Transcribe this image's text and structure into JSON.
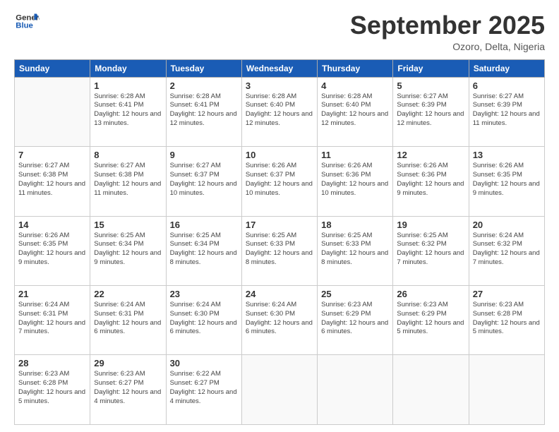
{
  "header": {
    "logo_line1": "General",
    "logo_line2": "Blue",
    "month": "September 2025",
    "location": "Ozoro, Delta, Nigeria"
  },
  "weekdays": [
    "Sunday",
    "Monday",
    "Tuesday",
    "Wednesday",
    "Thursday",
    "Friday",
    "Saturday"
  ],
  "weeks": [
    [
      {
        "day": "",
        "sunrise": "",
        "sunset": "",
        "daylight": ""
      },
      {
        "day": "1",
        "sunrise": "Sunrise: 6:28 AM",
        "sunset": "Sunset: 6:41 PM",
        "daylight": "Daylight: 12 hours and 13 minutes."
      },
      {
        "day": "2",
        "sunrise": "Sunrise: 6:28 AM",
        "sunset": "Sunset: 6:41 PM",
        "daylight": "Daylight: 12 hours and 12 minutes."
      },
      {
        "day": "3",
        "sunrise": "Sunrise: 6:28 AM",
        "sunset": "Sunset: 6:40 PM",
        "daylight": "Daylight: 12 hours and 12 minutes."
      },
      {
        "day": "4",
        "sunrise": "Sunrise: 6:28 AM",
        "sunset": "Sunset: 6:40 PM",
        "daylight": "Daylight: 12 hours and 12 minutes."
      },
      {
        "day": "5",
        "sunrise": "Sunrise: 6:27 AM",
        "sunset": "Sunset: 6:39 PM",
        "daylight": "Daylight: 12 hours and 12 minutes."
      },
      {
        "day": "6",
        "sunrise": "Sunrise: 6:27 AM",
        "sunset": "Sunset: 6:39 PM",
        "daylight": "Daylight: 12 hours and 11 minutes."
      }
    ],
    [
      {
        "day": "7",
        "sunrise": "Sunrise: 6:27 AM",
        "sunset": "Sunset: 6:38 PM",
        "daylight": "Daylight: 12 hours and 11 minutes."
      },
      {
        "day": "8",
        "sunrise": "Sunrise: 6:27 AM",
        "sunset": "Sunset: 6:38 PM",
        "daylight": "Daylight: 12 hours and 11 minutes."
      },
      {
        "day": "9",
        "sunrise": "Sunrise: 6:27 AM",
        "sunset": "Sunset: 6:37 PM",
        "daylight": "Daylight: 12 hours and 10 minutes."
      },
      {
        "day": "10",
        "sunrise": "Sunrise: 6:26 AM",
        "sunset": "Sunset: 6:37 PM",
        "daylight": "Daylight: 12 hours and 10 minutes."
      },
      {
        "day": "11",
        "sunrise": "Sunrise: 6:26 AM",
        "sunset": "Sunset: 6:36 PM",
        "daylight": "Daylight: 12 hours and 10 minutes."
      },
      {
        "day": "12",
        "sunrise": "Sunrise: 6:26 AM",
        "sunset": "Sunset: 6:36 PM",
        "daylight": "Daylight: 12 hours and 9 minutes."
      },
      {
        "day": "13",
        "sunrise": "Sunrise: 6:26 AM",
        "sunset": "Sunset: 6:35 PM",
        "daylight": "Daylight: 12 hours and 9 minutes."
      }
    ],
    [
      {
        "day": "14",
        "sunrise": "Sunrise: 6:26 AM",
        "sunset": "Sunset: 6:35 PM",
        "daylight": "Daylight: 12 hours and 9 minutes."
      },
      {
        "day": "15",
        "sunrise": "Sunrise: 6:25 AM",
        "sunset": "Sunset: 6:34 PM",
        "daylight": "Daylight: 12 hours and 9 minutes."
      },
      {
        "day": "16",
        "sunrise": "Sunrise: 6:25 AM",
        "sunset": "Sunset: 6:34 PM",
        "daylight": "Daylight: 12 hours and 8 minutes."
      },
      {
        "day": "17",
        "sunrise": "Sunrise: 6:25 AM",
        "sunset": "Sunset: 6:33 PM",
        "daylight": "Daylight: 12 hours and 8 minutes."
      },
      {
        "day": "18",
        "sunrise": "Sunrise: 6:25 AM",
        "sunset": "Sunset: 6:33 PM",
        "daylight": "Daylight: 12 hours and 8 minutes."
      },
      {
        "day": "19",
        "sunrise": "Sunrise: 6:25 AM",
        "sunset": "Sunset: 6:32 PM",
        "daylight": "Daylight: 12 hours and 7 minutes."
      },
      {
        "day": "20",
        "sunrise": "Sunrise: 6:24 AM",
        "sunset": "Sunset: 6:32 PM",
        "daylight": "Daylight: 12 hours and 7 minutes."
      }
    ],
    [
      {
        "day": "21",
        "sunrise": "Sunrise: 6:24 AM",
        "sunset": "Sunset: 6:31 PM",
        "daylight": "Daylight: 12 hours and 7 minutes."
      },
      {
        "day": "22",
        "sunrise": "Sunrise: 6:24 AM",
        "sunset": "Sunset: 6:31 PM",
        "daylight": "Daylight: 12 hours and 6 minutes."
      },
      {
        "day": "23",
        "sunrise": "Sunrise: 6:24 AM",
        "sunset": "Sunset: 6:30 PM",
        "daylight": "Daylight: 12 hours and 6 minutes."
      },
      {
        "day": "24",
        "sunrise": "Sunrise: 6:24 AM",
        "sunset": "Sunset: 6:30 PM",
        "daylight": "Daylight: 12 hours and 6 minutes."
      },
      {
        "day": "25",
        "sunrise": "Sunrise: 6:23 AM",
        "sunset": "Sunset: 6:29 PM",
        "daylight": "Daylight: 12 hours and 6 minutes."
      },
      {
        "day": "26",
        "sunrise": "Sunrise: 6:23 AM",
        "sunset": "Sunset: 6:29 PM",
        "daylight": "Daylight: 12 hours and 5 minutes."
      },
      {
        "day": "27",
        "sunrise": "Sunrise: 6:23 AM",
        "sunset": "Sunset: 6:28 PM",
        "daylight": "Daylight: 12 hours and 5 minutes."
      }
    ],
    [
      {
        "day": "28",
        "sunrise": "Sunrise: 6:23 AM",
        "sunset": "Sunset: 6:28 PM",
        "daylight": "Daylight: 12 hours and 5 minutes."
      },
      {
        "day": "29",
        "sunrise": "Sunrise: 6:23 AM",
        "sunset": "Sunset: 6:27 PM",
        "daylight": "Daylight: 12 hours and 4 minutes."
      },
      {
        "day": "30",
        "sunrise": "Sunrise: 6:22 AM",
        "sunset": "Sunset: 6:27 PM",
        "daylight": "Daylight: 12 hours and 4 minutes."
      },
      {
        "day": "",
        "sunrise": "",
        "sunset": "",
        "daylight": ""
      },
      {
        "day": "",
        "sunrise": "",
        "sunset": "",
        "daylight": ""
      },
      {
        "day": "",
        "sunrise": "",
        "sunset": "",
        "daylight": ""
      },
      {
        "day": "",
        "sunrise": "",
        "sunset": "",
        "daylight": ""
      }
    ]
  ]
}
